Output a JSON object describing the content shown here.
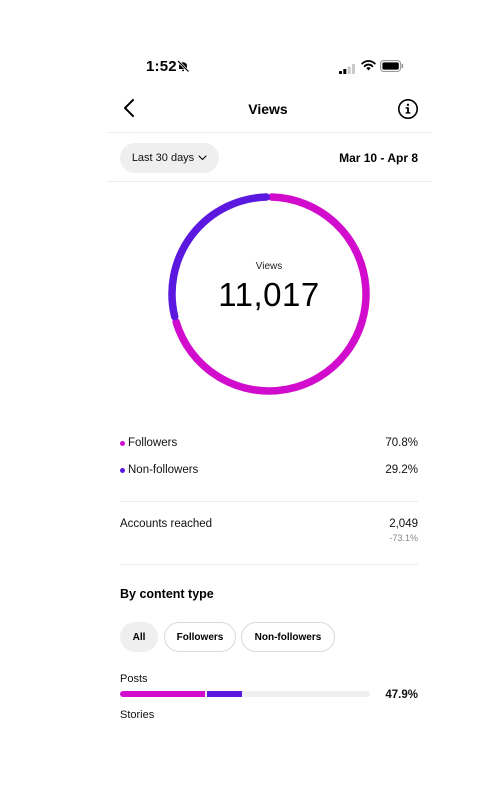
{
  "status_bar": {
    "time": "1:52"
  },
  "header": {
    "title": "Views"
  },
  "range": {
    "label": "Last 30 days",
    "date_range": "Mar 10 - Apr 8"
  },
  "donut": {
    "label": "Views",
    "value": "11,017",
    "segments": [
      {
        "name": "Followers",
        "fraction": 0.708,
        "color": "#d10ccd"
      },
      {
        "name": "Non-followers",
        "fraction": 0.292,
        "color": "#5b19e0"
      }
    ]
  },
  "legend": [
    {
      "label": "Followers",
      "value": "70.8%",
      "color": "#d10ccd"
    },
    {
      "label": "Non-followers",
      "value": "29.2%",
      "color": "#5b19e0"
    }
  ],
  "accounts_reached": {
    "label": "Accounts reached",
    "value": "2,049",
    "change": "-73.1%"
  },
  "content_type": {
    "title": "By content type",
    "filters": [
      "All",
      "Followers",
      "Non-followers"
    ],
    "selected_filter": "All",
    "items": [
      {
        "label": "Posts",
        "value": "47.9%",
        "followers_fraction": 0.34,
        "non_followers_fraction": 0.138
      },
      {
        "label": "Stories"
      }
    ]
  },
  "colors": {
    "followers": "#d10ccd",
    "non_followers": "#5b19e0",
    "track": "#efefef"
  }
}
